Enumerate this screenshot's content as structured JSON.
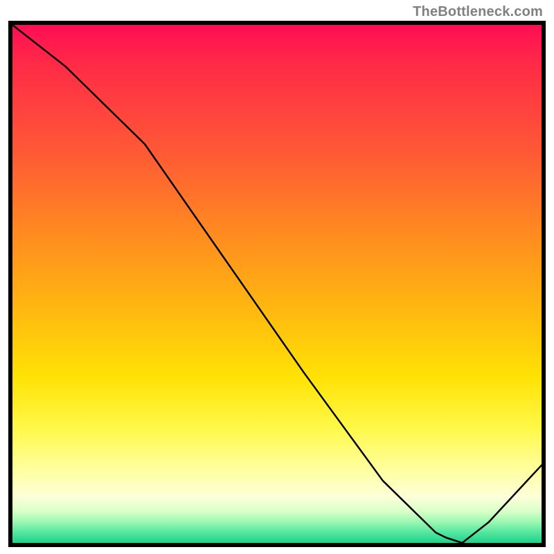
{
  "watermark": "TheBottleneck.com",
  "bottom_label": "",
  "chart_data": {
    "type": "line",
    "title": "",
    "xlabel": "",
    "ylabel": "",
    "xlim": [
      0,
      100
    ],
    "ylim": [
      0,
      100
    ],
    "series": [
      {
        "name": "curve",
        "x": [
          0,
          10,
          20,
          25,
          40,
          55,
          70,
          80,
          82,
          85,
          90,
          100
        ],
        "y": [
          100,
          92,
          82,
          77,
          55,
          33,
          12,
          2,
          1,
          0,
          4,
          15
        ]
      }
    ],
    "annotations": [
      {
        "text": "",
        "x": 83,
        "y": 2
      }
    ]
  },
  "colors": {
    "frame": "#000000",
    "curve": "#000000",
    "watermark": "#808080",
    "label": "#ff2a2a"
  }
}
